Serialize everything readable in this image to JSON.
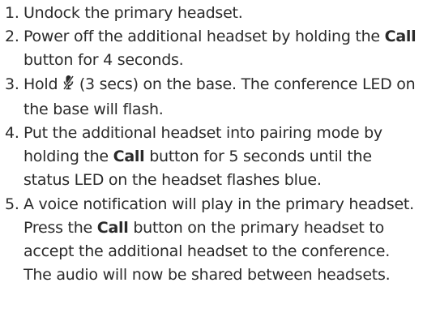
{
  "steps": [
    {
      "number": "1.",
      "parts": [
        "Undock the primary headset."
      ]
    },
    {
      "number": "2.",
      "parts": [
        "Power off the additional headset by holding the ",
        "Call",
        " button for 4 seconds."
      ]
    },
    {
      "number": "3.",
      "parts": [
        "Hold ",
        "(3 secs) on the base. The conference LED on the base will flash."
      ],
      "icon": "mic-mute-icon"
    },
    {
      "number": "4.",
      "parts": [
        "Put the additional headset into pairing mode by holding the ",
        "Call",
        " button for 5 seconds until the status LED on the headset flashes blue."
      ]
    },
    {
      "number": "5.",
      "parts": [
        "A voice notification will play in the primary headset. Press the ",
        "Call",
        " button on the primary headset to accept the additional headset to the conference. The audio will now be shared between headsets."
      ]
    }
  ]
}
